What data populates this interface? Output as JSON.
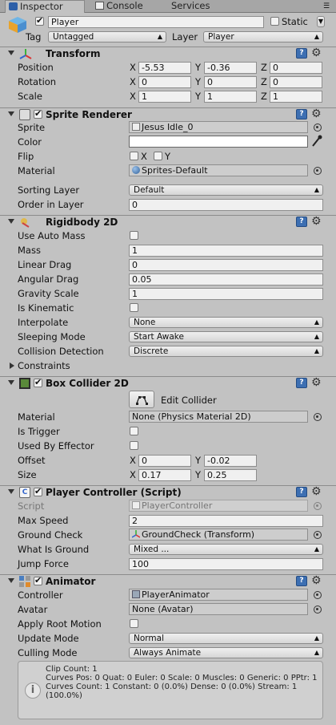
{
  "tabs": [
    {
      "label": "Inspector",
      "icon": "inspector-icon",
      "active": true
    },
    {
      "label": "Console",
      "icon": "console-icon",
      "active": false
    },
    {
      "label": "Services",
      "icon": "",
      "active": false
    }
  ],
  "object": {
    "name": "Player",
    "active": true,
    "static_label": "Static",
    "static_checked": false,
    "tag_label": "Tag",
    "tag_value": "Untagged",
    "layer_label": "Layer",
    "layer_value": "Player"
  },
  "transform": {
    "title": "Transform",
    "position_label": "Position",
    "rotation_label": "Rotation",
    "scale_label": "Scale",
    "position": {
      "x": "-5.53",
      "y": "-0.36",
      "z": "0"
    },
    "rotation": {
      "x": "0",
      "y": "0",
      "z": "0"
    },
    "scale": {
      "x": "1",
      "y": "1",
      "z": "1"
    }
  },
  "axis": {
    "x": "X",
    "y": "Y",
    "z": "Z"
  },
  "sprite_renderer": {
    "title": "Sprite Renderer",
    "sprite_label": "Sprite",
    "sprite_value": "Jesus Idle_0",
    "color_label": "Color",
    "color_value": "#ffffff",
    "flip_label": "Flip",
    "material_label": "Material",
    "material_value": "Sprites-Default",
    "sorting_layer_label": "Sorting Layer",
    "sorting_layer_value": "Default",
    "order_label": "Order in Layer",
    "order_value": "0"
  },
  "rigidbody": {
    "title": "Rigidbody 2D",
    "use_auto_mass_label": "Use Auto Mass",
    "mass_label": "Mass",
    "mass_value": "1",
    "linear_drag_label": "Linear Drag",
    "linear_drag_value": "0",
    "angular_drag_label": "Angular Drag",
    "angular_drag_value": "0.05",
    "gravity_scale_label": "Gravity Scale",
    "gravity_scale_value": "1",
    "is_kinematic_label": "Is Kinematic",
    "interpolate_label": "Interpolate",
    "interpolate_value": "None",
    "sleeping_mode_label": "Sleeping Mode",
    "sleeping_mode_value": "Start Awake",
    "collision_detection_label": "Collision Detection",
    "collision_detection_value": "Discrete",
    "constraints_label": "Constraints"
  },
  "box_collider": {
    "title": "Box Collider 2D",
    "edit_collider_label": "Edit Collider",
    "material_label": "Material",
    "material_value": "None (Physics Material 2D)",
    "is_trigger_label": "Is Trigger",
    "used_by_effector_label": "Used By Effector",
    "offset_label": "Offset",
    "offset": {
      "x": "0",
      "y": "-0.02"
    },
    "size_label": "Size",
    "size": {
      "x": "0.17",
      "y": "0.25"
    }
  },
  "player_controller": {
    "title": "Player Controller (Script)",
    "script_label": "Script",
    "script_value": "PlayerController",
    "max_speed_label": "Max Speed",
    "max_speed_value": "2",
    "ground_check_label": "Ground Check",
    "ground_check_value": "GroundCheck (Transform)",
    "what_is_ground_label": "What Is Ground",
    "what_is_ground_value": "Mixed ...",
    "jump_force_label": "Jump Force",
    "jump_force_value": "100"
  },
  "animator": {
    "title": "Animator",
    "controller_label": "Controller",
    "controller_value": "PlayerAnimator",
    "avatar_label": "Avatar",
    "avatar_value": "None (Avatar)",
    "apply_root_motion_label": "Apply Root Motion",
    "update_mode_label": "Update Mode",
    "update_mode_value": "Normal",
    "culling_mode_label": "Culling Mode",
    "culling_mode_value": "Always Animate",
    "info_lines": [
      "Clip Count: 1",
      "Curves Pos: 0 Quat: 0 Euler: 0 Scale: 0 Muscles: 0 Generic: 0 PPtr: 1",
      "Curves Count: 1 Constant: 0 (0.0%) Dense: 0 (0.0%) Stream: 1 (100.0%)"
    ]
  },
  "help_glyph": "?",
  "gear_glyph": "⚙"
}
